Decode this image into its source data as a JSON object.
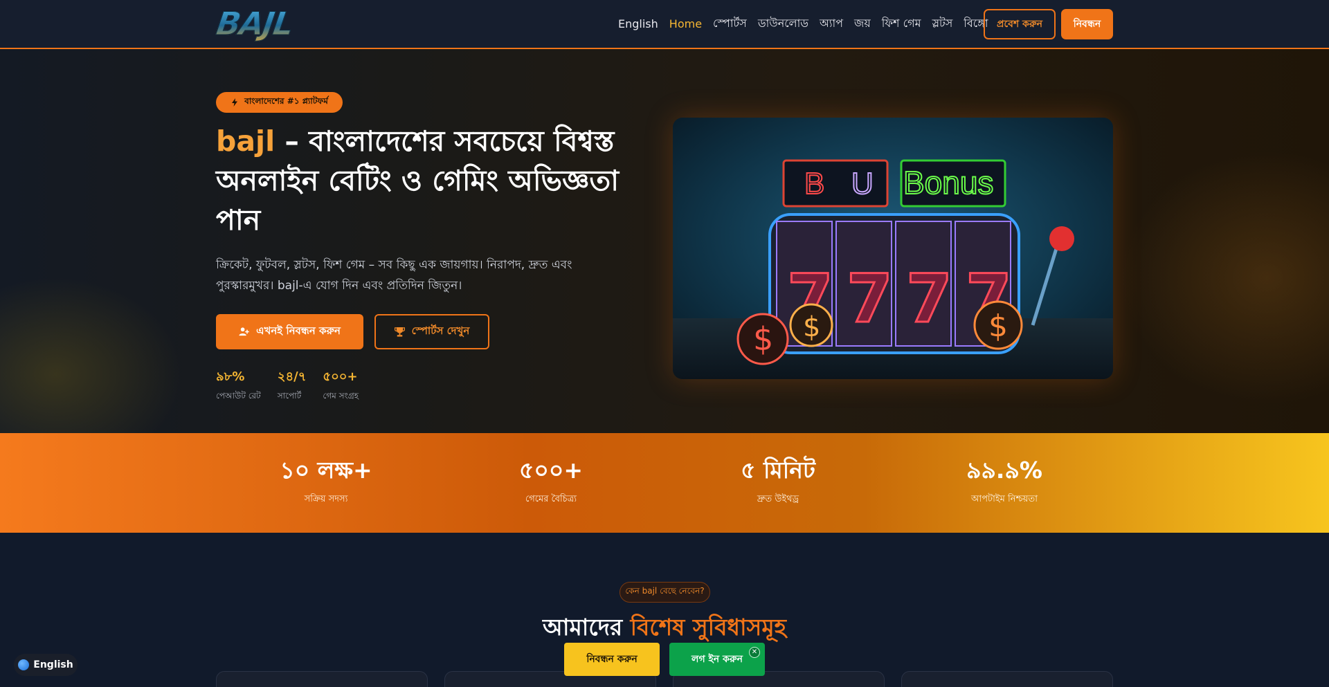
{
  "navbar": {
    "logo_text": "BAJL",
    "links": [
      "English",
      "Home",
      "স্পোর্টস",
      "ডাউনলোড",
      "অ্যাপ",
      "জয়",
      "ফিশ গেম",
      "স্লটস",
      "বিঙ্গো"
    ],
    "active_link": "Home",
    "login_label": "প্রবেশ করুন",
    "register_label": "নিবন্ধন"
  },
  "hero": {
    "badge": "বাংলাদেশের #১ প্ল্যাটফর্ম",
    "title_brand": "bajl",
    "title_rest": " – বাংলাদেশের সবচেয়ে বিশ্বস্ত অনলাইন বেটিং ও গেমিং অভিজ্ঞতা পান",
    "subtitle": "ক্রিকেট, ফুটবল, স্লটস, ফিশ গেম – সব কিছু এক জায়গায়। নিরাপদ, দ্রুত এবং পুরস্কারমুখর। bajl-এ যোগ দিন এবং প্রতিদিন জিতুন।",
    "primary_button": "এখনই নিবন্ধন করুন",
    "secondary_button": "স্পোর্টস দেখুন",
    "mini_stats": [
      {
        "value": "৯৮%",
        "label": "পেআউট রেট"
      },
      {
        "value": "২৪/৭",
        "label": "সাপোর্ট"
      },
      {
        "value": "৫০০+",
        "label": "গেম সংগ্রহ"
      }
    ],
    "image_signs": [
      "B",
      "U",
      "Bonus"
    ]
  },
  "stats": [
    {
      "number": "১০ লক্ষ+",
      "caption": "সক্রিয় সদস্য"
    },
    {
      "number": "৫০০+",
      "caption": "গেমের বৈচিত্র্য"
    },
    {
      "number": "৫ মিনিট",
      "caption": "দ্রুত উইথড্র"
    },
    {
      "number": "৯৯.৯%",
      "caption": "আপটাইম নিশ্চয়তা"
    }
  ],
  "features": {
    "pill": "কেন bajl বেছে নেবেন?",
    "title_plain": "আমাদের ",
    "title_highlight": "বিশেষ সুবিধাসমূহ"
  },
  "floating": {
    "language": "English",
    "register": "নিবন্ধন করুন",
    "login": "লগ ইন করুন",
    "close": "✕"
  },
  "colors": {
    "accent": "#f07418",
    "gold": "#f7b733",
    "background": "#111a2b",
    "login_green": "#0ca24a"
  }
}
